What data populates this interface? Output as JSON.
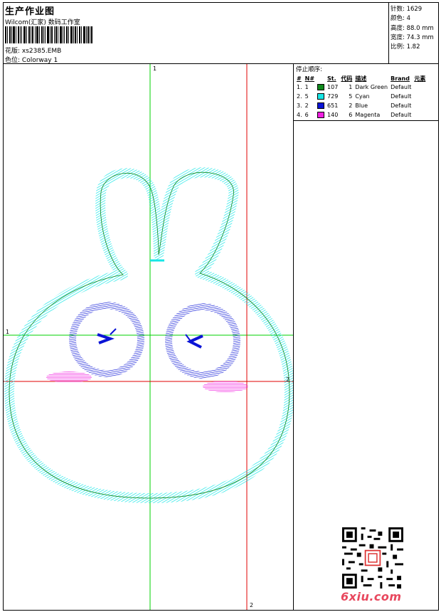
{
  "header": {
    "title": "生产作业图",
    "company": "Wilcom(汇家) 数码工作室",
    "design_label": "花版:",
    "design_value": "xs2385.EMB",
    "colorway_label": "色位:",
    "colorway_value": "Colorway 1"
  },
  "stats": {
    "stitches": "针数: 1629",
    "colors": "颜色: 4",
    "height": "高度: 88.0 mm",
    "width": "宽度: 74.3 mm",
    "scale": "比例: 1.82"
  },
  "legend": {
    "title": "停止顺序:",
    "columns": [
      "#",
      "N#",
      "St.",
      "代码",
      "描述",
      "Brand",
      "元素"
    ],
    "rows": [
      {
        "idx": "1.",
        "n": "1",
        "st": "107",
        "code": "1",
        "desc": "Dark Green",
        "brand": "Default",
        "color": "#0f8a1e"
      },
      {
        "idx": "2.",
        "n": "5",
        "st": "729",
        "code": "5",
        "desc": "Cyan",
        "brand": "Default",
        "color": "#17e6e6"
      },
      {
        "idx": "3.",
        "n": "2",
        "st": "651",
        "code": "2",
        "desc": "Blue",
        "brand": "Default",
        "color": "#0a14d6"
      },
      {
        "idx": "4.",
        "n": "6",
        "st": "140",
        "code": "6",
        "desc": "Magenta",
        "brand": "Default",
        "color": "#f01ee0"
      }
    ]
  },
  "canvas": {
    "guide_labels": {
      "top": "1",
      "left": "1",
      "right": "2",
      "bottom": "2"
    },
    "colors": {
      "guide_green": "#00d000",
      "guide_red": "#e00000",
      "outline_cyan": "#17e6e6",
      "outline_dark": "#0f8a1e",
      "eye_blue": "#0a14d6",
      "cheek": "#f01ee0"
    }
  },
  "footer": {
    "site": "6xiu.com"
  }
}
